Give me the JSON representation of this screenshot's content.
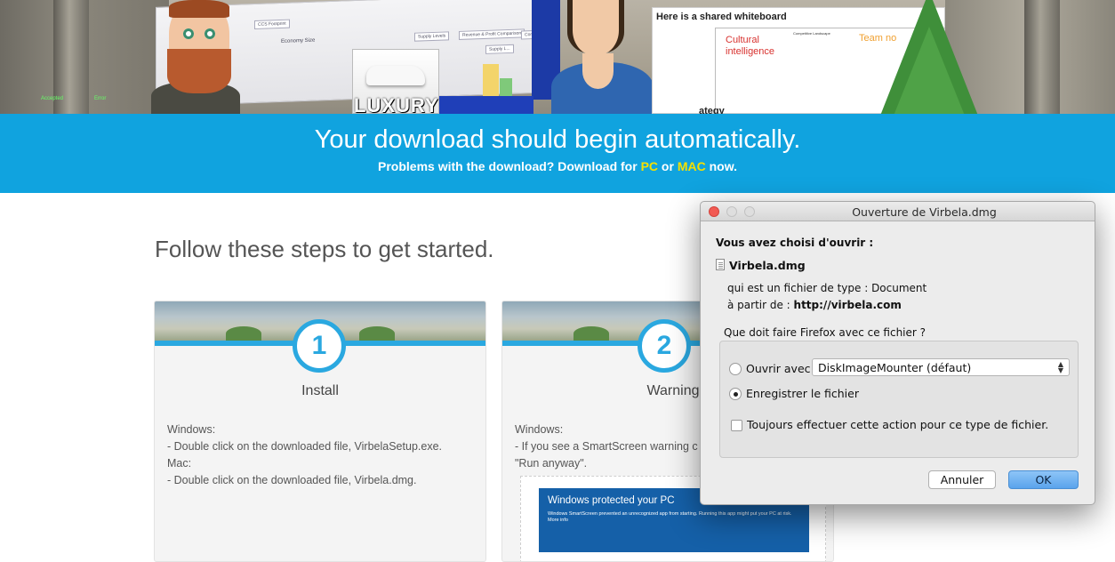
{
  "hero": {
    "luxury_sign": "LUXURY",
    "whiteboard": {
      "title": "Here is a shared whiteboard",
      "cultural": "Cultural intelligence",
      "competitive": "Competitive Landscape",
      "team": "Team no",
      "strategy": "ategy"
    },
    "screen": {
      "tab": "CCS Footprint",
      "heading": "Economy Size",
      "cells": [
        "Supply Levels",
        "Revenue & Profit Comparison",
        "Comparison",
        "Supply L..."
      ]
    },
    "left_labels": [
      "Accepted",
      "Error"
    ]
  },
  "banner": {
    "headline": "Your download should begin automatically.",
    "sub_prefix": "Problems with the download? Download for ",
    "pc_link": "PC",
    "or": " or ",
    "mac_link": "MAC",
    "sub_suffix": " now."
  },
  "steps": {
    "title": "Follow these steps to get started.",
    "cards": [
      {
        "number": "1",
        "title": "Install",
        "lines": [
          "Windows:",
          "- Double click on the downloaded file, VirbelaSetup.exe.",
          "Mac:",
          "- Double click on the downloaded file, Virbela.dmg."
        ]
      },
      {
        "number": "2",
        "title": "Warnings",
        "lines": [
          "Windows:",
          "- If you see a SmartScreen warning c",
          "\"Run anyway\"."
        ],
        "smartscreen": {
          "title": "Windows protected your PC",
          "text": "Windows SmartScreen prevented an unrecognized app from starting. Running this app might put your PC at risk.",
          "more": "More info"
        }
      }
    ]
  },
  "dialog": {
    "title": "Ouverture de Virbela.dmg",
    "chosen_label": "Vous avez choisi d'ouvrir :",
    "file_name": "Virbela.dmg",
    "file_type": "qui est un fichier de type : Document",
    "source_prefix": "à partir de : ",
    "source_url": "http://virbela.com",
    "question": "Que doit faire Firefox avec ce fichier ?",
    "open_with_label": "Ouvrir avec",
    "open_with_value": "DiskImageMounter (défaut)",
    "save_label": "Enregistrer le fichier",
    "always_label": "Toujours effectuer cette action pour ce type de fichier.",
    "cancel_label": "Annuler",
    "ok_label": "OK",
    "selected_option": "save"
  }
}
